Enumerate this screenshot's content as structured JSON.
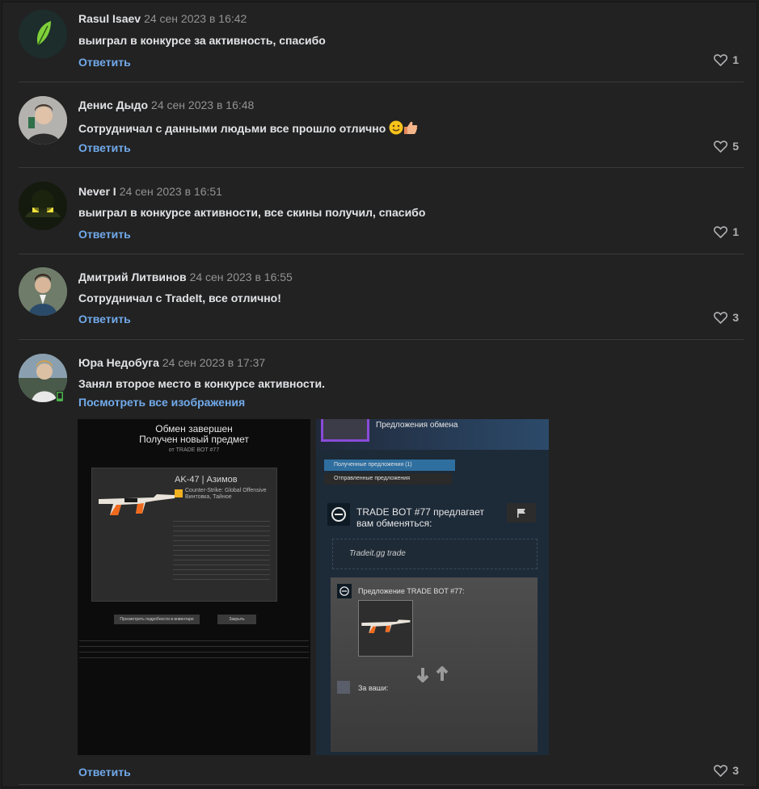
{
  "comments": [
    {
      "author": "Rasul Isaev",
      "date": "24 сен 2023 в 16:42",
      "text": "выиграл в конкурсе за активность, спасибо",
      "reply_label": "Ответить",
      "likes": "1",
      "avatar_icon": "leaf-logo-icon"
    },
    {
      "author": "Денис Дыдо",
      "date": "24 сен 2023 в 16:48",
      "text": "Сотрудничал с данными людьми все прошло отлично",
      "emojis": [
        "smile-emoji-icon",
        "thumbs-up-emoji-icon"
      ],
      "reply_label": "Ответить",
      "likes": "5"
    },
    {
      "author": "Never I",
      "date": "24 сен 2023 в 16:51",
      "text": "выиграл в конкурсе активности, все скины получил, спасибо",
      "reply_label": "Ответить",
      "likes": "1"
    },
    {
      "author": "Дмитрий Литвинов",
      "date": "24 сен 2023 в 16:55",
      "text": "Сотрудничал с TradeIt, все отлично!",
      "reply_label": "Ответить",
      "likes": "3"
    },
    {
      "author": "Юра Недобуга",
      "date": "24 сен 2023 в 17:37",
      "text": "Занял второе место в конкурсе активности.",
      "view_all_images": "Посмотреть все изображения",
      "reply_label": "Ответить",
      "likes": "3"
    }
  ],
  "attachment_1": {
    "title_1": "Обмен завершен",
    "title_2": "Получен новый предмет",
    "from": "от TRADE BOT #77",
    "item_name": "AK-47 | Азимов",
    "item_game": "Counter-Strike: Global Offensive",
    "item_type": "Винтовка, Тайное",
    "button_1": "Просмотреть подробности в инвентаре",
    "button_2": "Закрыть"
  },
  "attachment_2": {
    "header": "Предложения обмена",
    "tab_received": "Полученные предложения (1)",
    "tab_sent": "Отправленные предложения",
    "offer_title": "TRADE BOT #77 предлагает вам обменяться:",
    "message": "Tradeit.gg trade",
    "offer_label": "Предложение TRADE BOT #77:",
    "for_yours": "За ваши:"
  },
  "colors": {
    "background": "#222222",
    "link": "#71aaeb",
    "meta": "#939393"
  }
}
